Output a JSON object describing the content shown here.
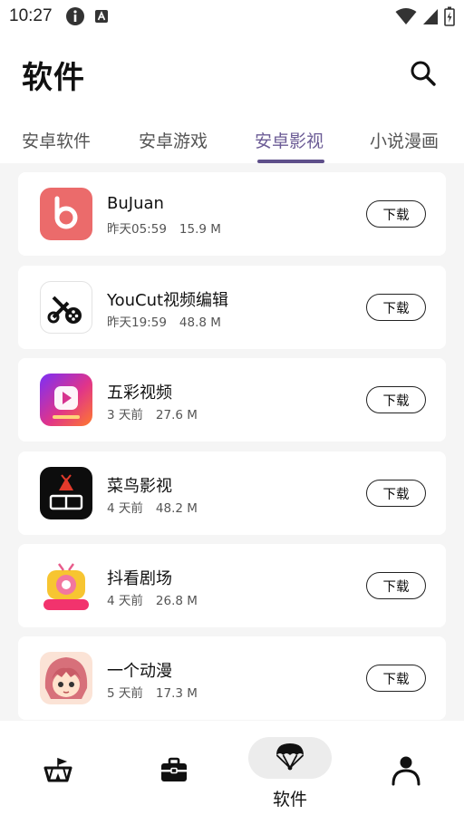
{
  "status_bar": {
    "time": "10:27"
  },
  "header": {
    "title": "软件"
  },
  "tabs": [
    {
      "label": "安卓软件"
    },
    {
      "label": "安卓游戏"
    },
    {
      "label": "安卓影视"
    },
    {
      "label": "小说漫画"
    }
  ],
  "active_tab": 2,
  "apps": [
    {
      "name": "BuJuan",
      "time": "昨天05:59",
      "size": "15.9 M",
      "download_label": "下载",
      "icon": "bujuan-icon"
    },
    {
      "name": "YouCut视频编辑",
      "time": "昨天19:59",
      "size": "48.8 M",
      "download_label": "下载",
      "icon": "youcut-icon"
    },
    {
      "name": "五彩视频",
      "time": "3 天前",
      "size": "27.6 M",
      "download_label": "下载",
      "icon": "wucai-video-icon"
    },
    {
      "name": "菜鸟影视",
      "time": "4 天前",
      "size": "48.2 M",
      "download_label": "下载",
      "icon": "cainiao-video-icon"
    },
    {
      "name": "抖看剧场",
      "time": "4 天前",
      "size": "26.8 M",
      "download_label": "下载",
      "icon": "doukan-theater-icon"
    },
    {
      "name": "一个动漫",
      "time": "5 天前",
      "size": "17.3 M",
      "download_label": "下载",
      "icon": "anime-icon"
    }
  ],
  "bottom_nav": {
    "active_label": "软件"
  },
  "colors": {
    "accent": "#5e4f8a",
    "tab_active_text": "#6b5b95"
  }
}
